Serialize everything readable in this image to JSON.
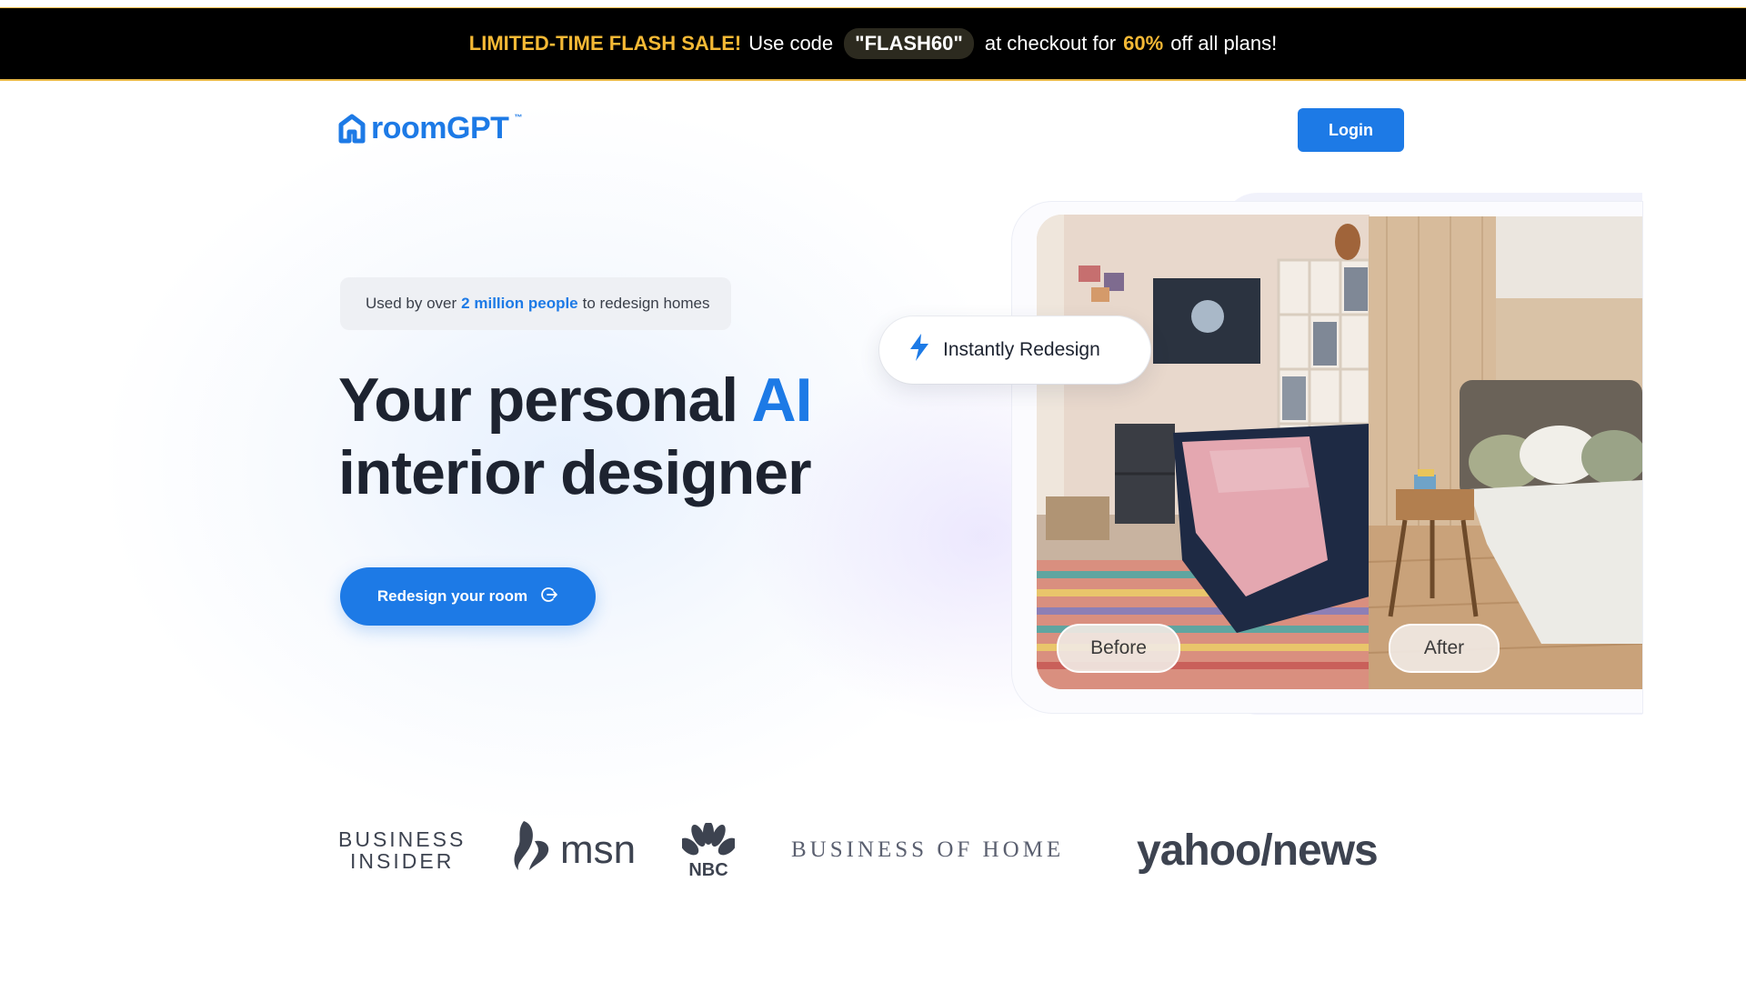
{
  "promo": {
    "sale_label": "LIMITED-TIME FLASH SALE!",
    "use_code_text": "Use code",
    "code": "\"FLASH60\"",
    "at_checkout_text": "at checkout for",
    "discount": "60%",
    "tail_text": "off all plans!"
  },
  "header": {
    "logo_text": "roomGPT",
    "logo_tm": "™",
    "login_label": "Login"
  },
  "hero": {
    "badge_prefix": "Used by over",
    "badge_highlight": "2 million people",
    "badge_suffix": "to redesign homes",
    "headline_part1": "Your personal",
    "headline_ai": "AI",
    "headline_part2": "interior designer",
    "cta_label": "Redesign your room"
  },
  "showcase": {
    "instant_label": "Instantly Redesign",
    "before_label": "Before",
    "after_label": "After"
  },
  "press": {
    "business_insider_line1": "BUSINESS",
    "business_insider_line2": "INSIDER",
    "msn": "msn",
    "nbc": "NBC",
    "business_of_home": "BUSINESS OF HOME",
    "yahoo_news": "yahoo/news"
  },
  "colors": {
    "accent": "#1d7ae6",
    "promo_highlight": "#f5b935",
    "promo_bg": "#000000",
    "headline": "#1d2330"
  },
  "icons": {
    "logo": "house-icon",
    "cta": "arrow-circle-icon",
    "instant": "lightning-bolt-icon"
  }
}
